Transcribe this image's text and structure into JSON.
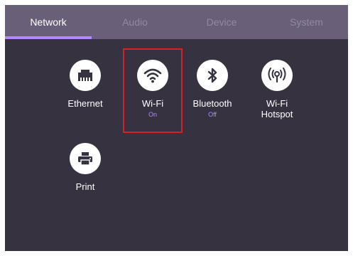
{
  "tabs": [
    {
      "label": "Network",
      "active": true
    },
    {
      "label": "Audio",
      "active": false
    },
    {
      "label": "Device",
      "active": false
    },
    {
      "label": "System",
      "active": false
    }
  ],
  "network_items": [
    {
      "label": "Ethernet",
      "status": "",
      "icon": "ethernet-icon"
    },
    {
      "label": "Wi-Fi",
      "status": "On",
      "icon": "wifi-icon",
      "highlighted": true
    },
    {
      "label": "Bluetooth",
      "status": "Off",
      "icon": "bluetooth-icon"
    },
    {
      "label": "Wi-Fi\nHotspot",
      "status": "",
      "icon": "hotspot-icon"
    },
    {
      "label": "Print",
      "status": "",
      "icon": "printer-icon"
    }
  ],
  "colors": {
    "panel_bg": "#37323f",
    "tabbar_bg": "#6a5f79",
    "accent": "#b388ff",
    "highlight_border": "#d9202a"
  }
}
